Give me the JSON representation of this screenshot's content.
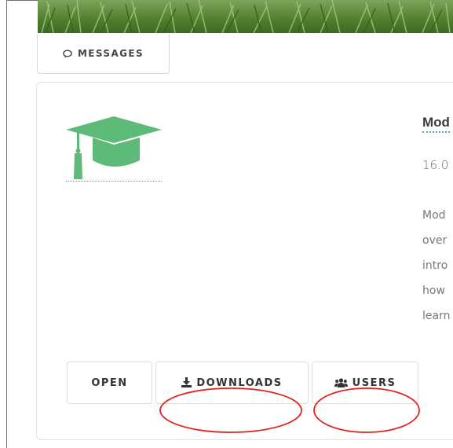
{
  "tabs": [
    {
      "label": "MESSAGES",
      "icon": "comments-icon"
    }
  ],
  "module": {
    "title": "Mod",
    "date": "16.0",
    "description_lines": [
      "Mod",
      "over",
      "intro",
      "how",
      "learn"
    ]
  },
  "actions": {
    "open_label": "OPEN",
    "downloads_label": "DOWNLOADS",
    "downloads_icon": "download-icon",
    "users_label": "USERS",
    "users_icon": "users-icon"
  },
  "colors": {
    "cap_green": "#5dba78",
    "annotation_red": "#e0241b",
    "grass": "#5a8a33"
  }
}
